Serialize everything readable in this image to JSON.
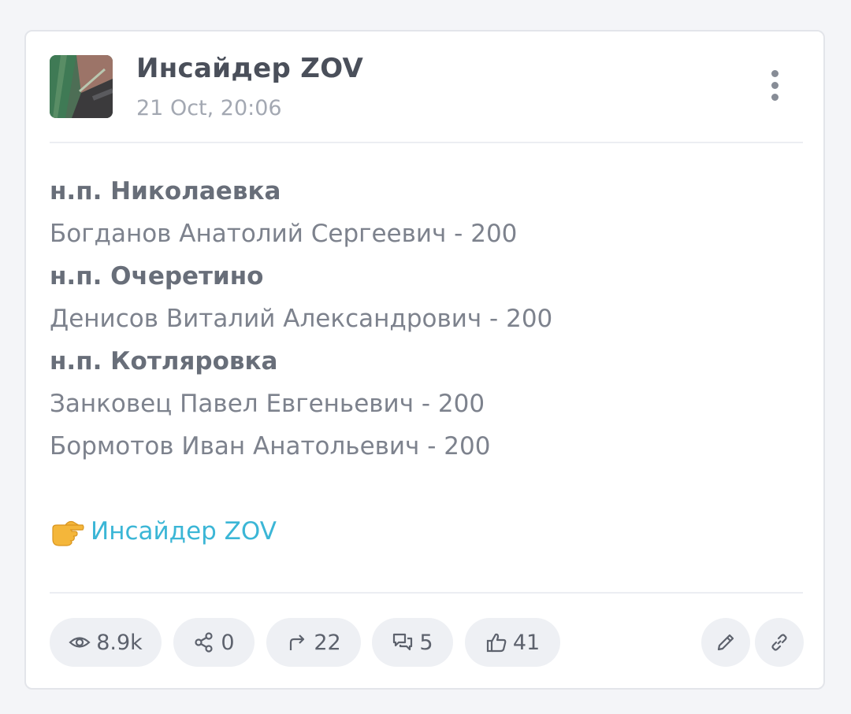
{
  "post": {
    "channel_name": "Инсайдер ZOV",
    "date": "21 Oct, 20:06",
    "lines": [
      {
        "text": "н.п. Николаевка",
        "bold": true
      },
      {
        "text": "Богданов Анатолий Сергеевич - 200",
        "bold": false
      },
      {
        "text": "н.п. Очеретино",
        "bold": true
      },
      {
        "text": "Денисов Виталий Александрович - 200",
        "bold": false
      },
      {
        "text": "н.п. Котляровка",
        "bold": true
      },
      {
        "text": "Занковец Павел Евгеньевич - 200",
        "bold": false
      },
      {
        "text": "Бормотов Иван Анатольевич - 200",
        "bold": false
      }
    ],
    "link_text": "Инсайдер ZOV",
    "link_emoji": "pointing-right-hand-icon"
  },
  "stats": {
    "views": "8.9k",
    "shares": "0",
    "forwards": "22",
    "comments": "5",
    "reactions": "41"
  },
  "icons": {
    "menu": "more-vertical-icon",
    "views": "eye-icon",
    "shares": "share-nodes-icon",
    "forwards": "forward-arrow-icon",
    "comments": "comments-icon",
    "reactions": "thumbs-up-icon",
    "edit": "pencil-icon",
    "link": "link-icon"
  },
  "colors": {
    "link": "#3bb6d6",
    "title": "#4a4f5a",
    "text": "#7d828d",
    "muted": "#a3a8b2",
    "pill_bg": "#eef0f4"
  }
}
